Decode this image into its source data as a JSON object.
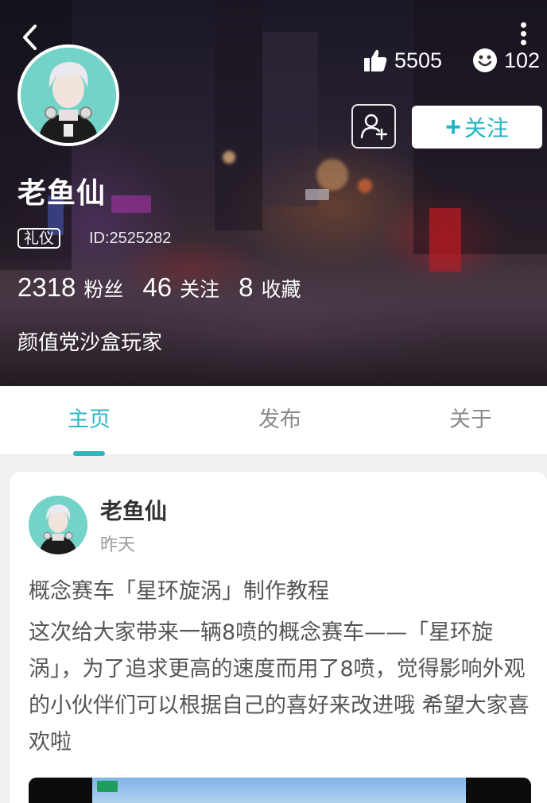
{
  "profile": {
    "name": "老鱼仙",
    "badge": "礼仪",
    "id_text": "ID:2525282",
    "likes": "5505",
    "smiles": "102",
    "follow_label": "关注",
    "follow_plus": "+",
    "followers": {
      "count": "2318",
      "label": "粉丝"
    },
    "following": {
      "count": "46",
      "label": "关注"
    },
    "favorites": {
      "count": "8",
      "label": "收藏"
    },
    "bio": "颜值党沙盒玩家"
  },
  "icons": {
    "back": "back-arrow-icon",
    "more": "more-vertical-icon",
    "like": "thumbs-up-icon",
    "smile": "smiley-icon",
    "add_friend": "add-friend-icon"
  },
  "tabs": [
    {
      "label": "主页",
      "active": true
    },
    {
      "label": "发布",
      "active": false
    },
    {
      "label": "关于",
      "active": false
    }
  ],
  "post": {
    "author": "老鱼仙",
    "time": "昨天",
    "title": "概念赛车「星环旋涡」制作教程",
    "body": "这次给大家带来一辆8喷的概念赛车——「星环旋涡」，为了追求更高的速度而用了8喷，觉得影响外观的小伙伴们可以根据自己的喜好来改进哦 希望大家喜欢啦"
  },
  "colors": {
    "accent": "#2eb6c5",
    "follow_text": "#1eb7c4",
    "tab_inactive": "#8a8a8a",
    "body_text": "#555555"
  }
}
